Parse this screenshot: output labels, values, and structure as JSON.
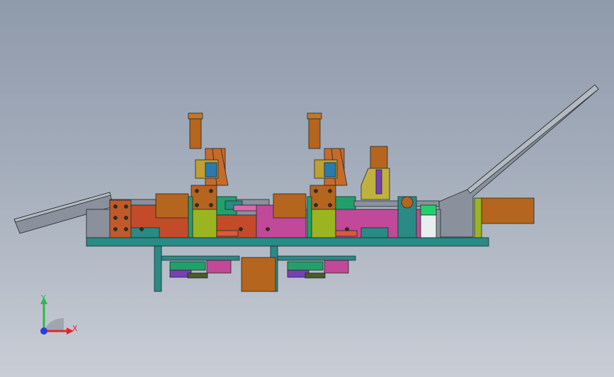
{
  "viewport": {
    "background_top": "#8f9aab",
    "background_bottom": "#c9ced6"
  },
  "triad": {
    "x_label": "X",
    "y_label": "Y",
    "x_color": "#e0262b",
    "y_color": "#2fb84a",
    "z_color": "#2b3fd8"
  },
  "palette": {
    "base_teal": "#2a8a86",
    "copper": "#b5651d",
    "rust": "#c44b2a",
    "magenta": "#c2489a",
    "olive": "#9ab520",
    "steel": "#8a909c",
    "green": "#22a06b",
    "purple": "#7a3fb5"
  }
}
